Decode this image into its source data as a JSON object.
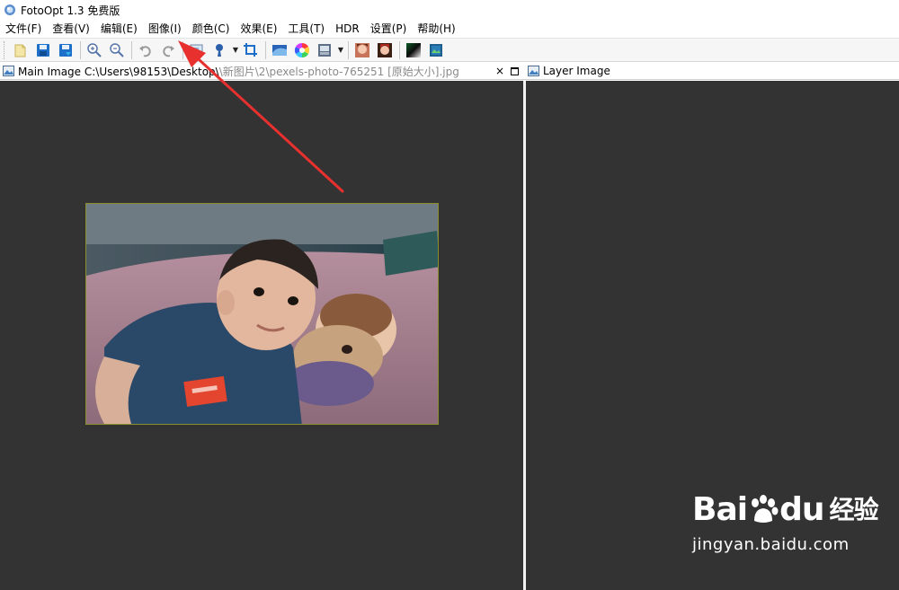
{
  "window": {
    "title": "FotoOpt 1.3 免费版"
  },
  "menu": [
    {
      "label": "文件(F)"
    },
    {
      "label": "查看(V)"
    },
    {
      "label": "编辑(E)"
    },
    {
      "label": "图像(I)"
    },
    {
      "label": "颜色(C)"
    },
    {
      "label": "效果(E)"
    },
    {
      "label": "工具(T)"
    },
    {
      "label": "HDR"
    },
    {
      "label": "设置(P)"
    },
    {
      "label": "帮助(H)"
    }
  ],
  "toolbar": {
    "icons": [
      "open-icon",
      "save-icon",
      "save-as-icon",
      "zoom-in-icon",
      "zoom-out-icon",
      "undo-icon",
      "redo-icon",
      "resize-icon",
      "brush-icon",
      "crop-icon",
      "levels-icon",
      "color-wheel-icon",
      "frame-icon",
      "portrait-icon",
      "portrait-retouch-icon",
      "gradient-icon",
      "image-icon"
    ]
  },
  "main_panel": {
    "title_prefix": "Main Image C:\\Users\\98153\\Desktop\\",
    "title_faded": "\\新图片\\2\\pexels-photo-765251 [原始大小].jpg",
    "close_label": "×"
  },
  "layer_panel": {
    "title": "Layer Image"
  },
  "colors": {
    "canvas": "#333333",
    "annotation_arrow": "#e8302f"
  },
  "watermark": {
    "logo_text": "Bai",
    "logo_text2": "du",
    "logo_cn": "经验",
    "url": "jingyan.baidu.com"
  }
}
